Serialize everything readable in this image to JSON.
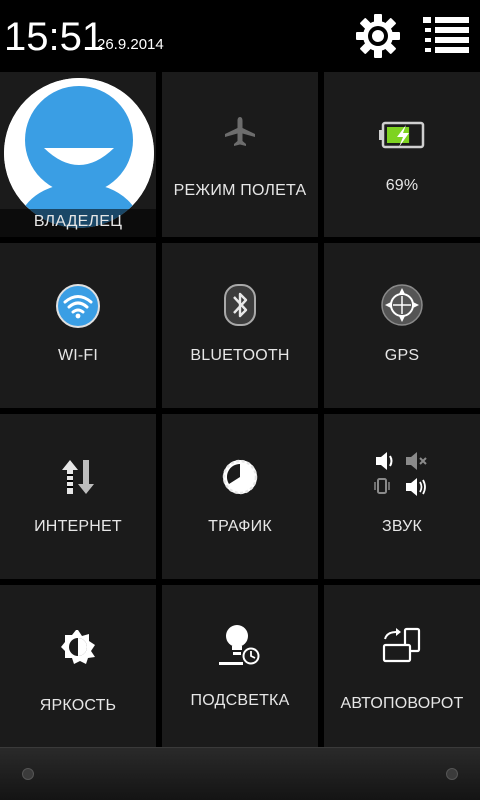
{
  "status": {
    "time": "15:51",
    "date": "26.9.2014"
  },
  "header": {
    "settings_icon": "gear-icon",
    "list_icon": "list-icon"
  },
  "tiles": {
    "owner": {
      "label": "ВЛАДЕЛЕЦ",
      "icon": "avatar-icon"
    },
    "airplane": {
      "label": "РЕЖИМ ПОЛЕТА",
      "icon": "airplane-icon"
    },
    "battery": {
      "label": "69%",
      "icon": "battery-charging-icon",
      "level": 0.69
    },
    "wifi": {
      "label": "WI-FI",
      "icon": "wifi-icon"
    },
    "bluetooth": {
      "label": "BLUETOOTH",
      "icon": "bluetooth-icon"
    },
    "gps": {
      "label": "GPS",
      "icon": "gps-icon"
    },
    "internet": {
      "label": "ИНТЕРНЕТ",
      "icon": "data-transfer-icon"
    },
    "traffic": {
      "label": "ТРАФИК",
      "icon": "traffic-icon"
    },
    "sound": {
      "label": "ЗВУК",
      "icon": "sound-modes-icon"
    },
    "brightness": {
      "label": "ЯРКОСТЬ",
      "icon": "brightness-icon"
    },
    "backlight": {
      "label": "ПОДСВЕТКА",
      "icon": "backlight-icon"
    },
    "autorotate": {
      "label": "АВТОПОВОРОТ",
      "icon": "autorotate-icon"
    }
  },
  "colors": {
    "accent_blue": "#3a9ee4",
    "battery_green": "#7ed321",
    "tile_bg": "#1b1b1b"
  }
}
